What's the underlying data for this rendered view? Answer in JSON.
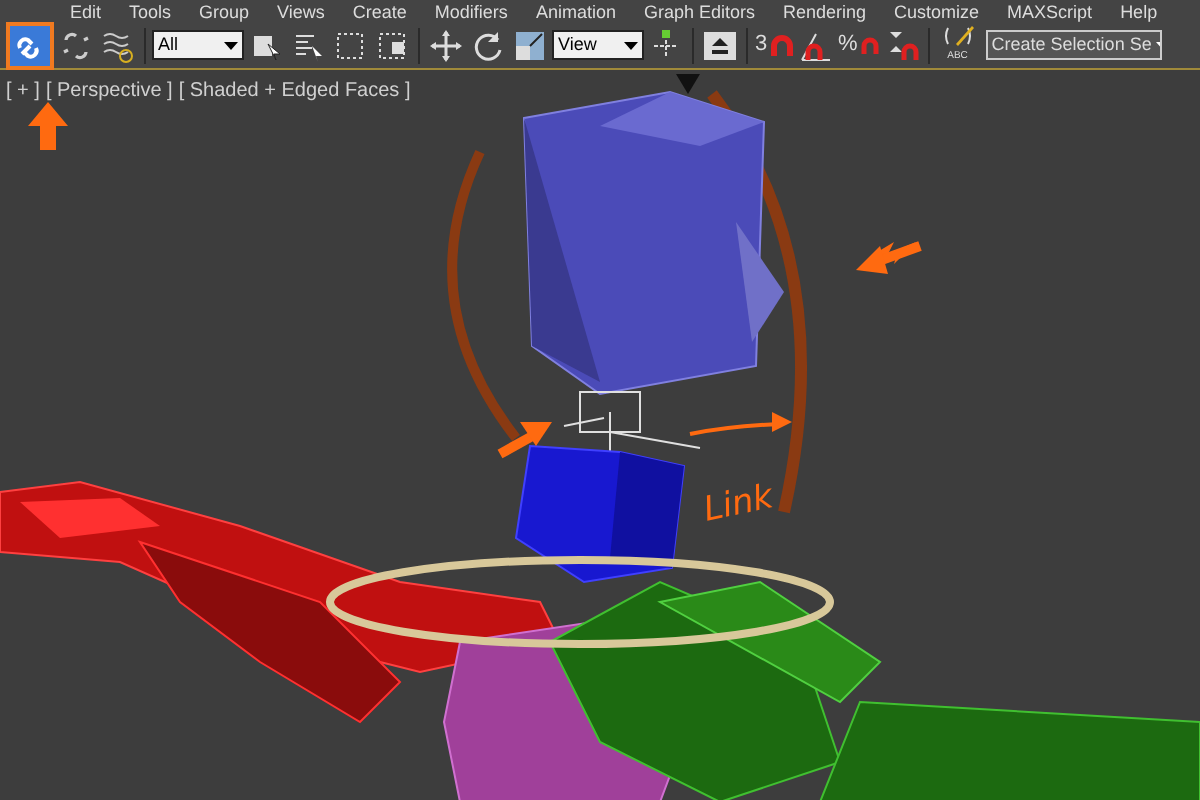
{
  "menu_bar": [
    "Edit",
    "Tools",
    "Group",
    "Views",
    "Create",
    "Modifiers",
    "Animation",
    "Graph Editors",
    "Rendering",
    "Customize",
    "MAXScript",
    "Help"
  ],
  "toolbar": {
    "buttons": [
      {
        "selected": true
      },
      {
        "selected": false
      },
      {
        "selected": false
      },
      {
        "selected": false
      },
      {
        "selected": false
      },
      {
        "selected": false
      },
      {
        "selected": false
      },
      {
        "selected": false
      },
      {
        "selected": false
      },
      {
        "selected": false
      },
      {
        "selected": false
      },
      {
        "selected": false
      },
      {
        "selected": false
      },
      {
        "selected": false
      },
      {
        "selected": false
      },
      {
        "selected": false
      },
      {
        "selected": false
      }
    ],
    "selection_filter": "All",
    "reference_coordinate_system": "View",
    "snap_label": "3",
    "percent_snap_label": "%",
    "edit_named_label": "ABC",
    "named_selection_placeholder": "Create Selection Se"
  },
  "viewport": {
    "labels": [
      "[ + ]",
      "[ Perspective ]",
      "[ Shaded + Edged Faces ]"
    ],
    "annotation": "Link"
  }
}
